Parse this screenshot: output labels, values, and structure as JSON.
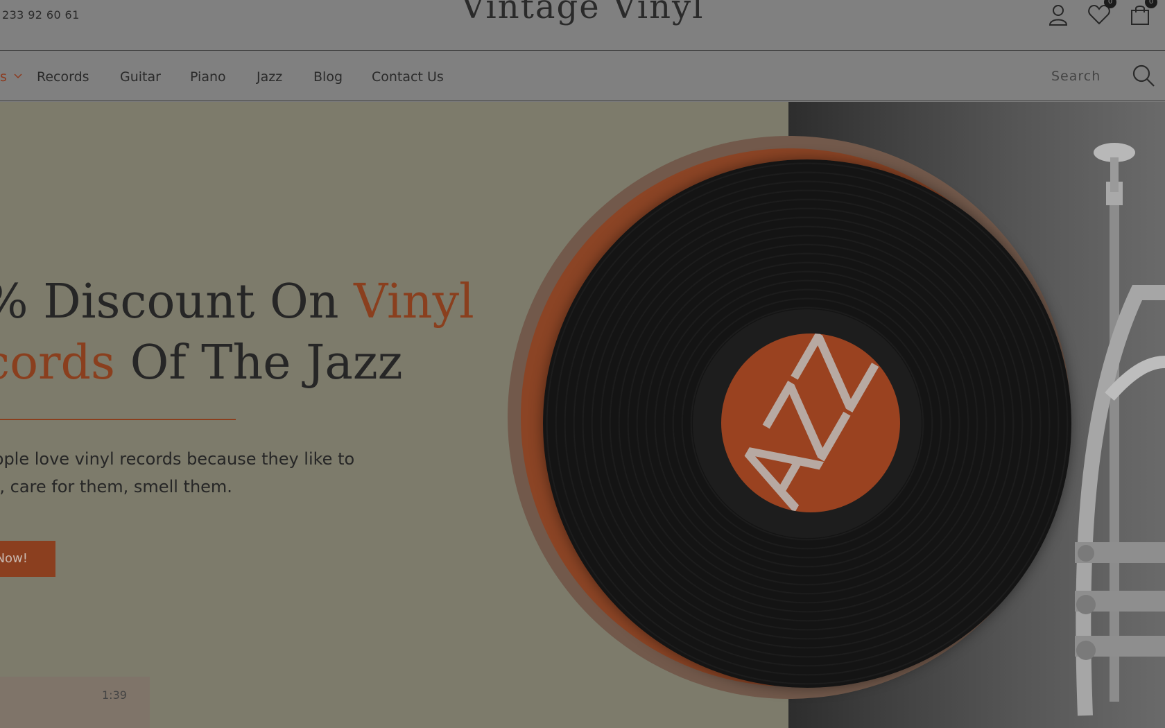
{
  "header": {
    "phone": "233 92 60 61",
    "logo": "Vintage Vinyl",
    "wishlist_count": "0",
    "cart_count": "0"
  },
  "nav": {
    "partial_item": "s",
    "items": [
      "Records",
      "Guitar",
      "Piano",
      "Jazz",
      "Blog",
      "Contact Us"
    ],
    "search_placeholder": "Search"
  },
  "hero": {
    "headline_line1_start": "% Discount On ",
    "headline_line1_accent": "Vinyl",
    "headline_line2_accent": "cords",
    "headline_line2_rest": " Of The Jazz",
    "desc_line1": "eople love vinyl records because they like to",
    "desc_line2": "m, care for them, smell them.",
    "button_label": "Now!",
    "label_text": "JAZZ",
    "player_time": "1:39"
  },
  "colors": {
    "accent": "#8a3f1e",
    "overlay_bg": "#7f7f7f",
    "hero_bg": "#7d7b6b"
  }
}
